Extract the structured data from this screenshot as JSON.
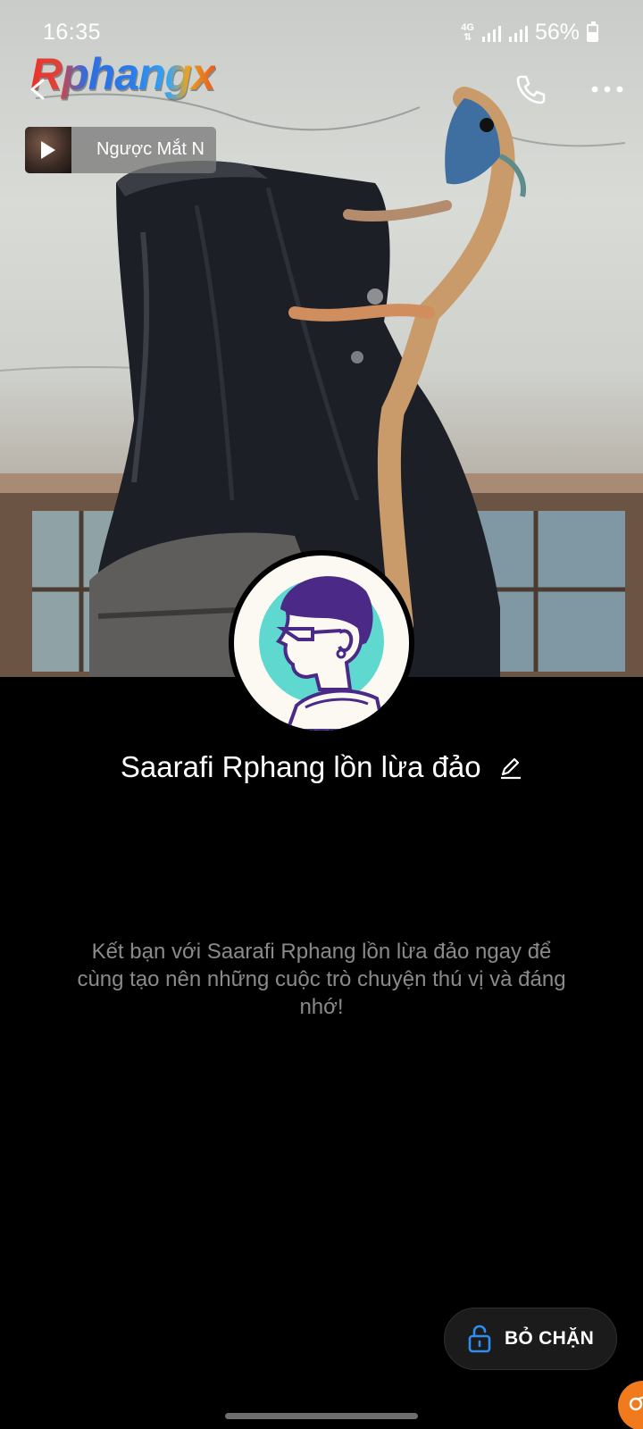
{
  "status_bar": {
    "time": "16:35",
    "network": "4G",
    "battery": "56%",
    "battery_level": 0.56
  },
  "header": {
    "logo_text": "Rphangx"
  },
  "music": {
    "title": "Ngược Mắt N"
  },
  "profile": {
    "name": "Saarafi Rphang lồn lừa đảo"
  },
  "friend_prompt": "Kết bạn với Saarafi Rphang lồn lừa đảo ngay để cùng tạo nên những cuộc trò chuyện thú vị và đáng nhớ!",
  "actions": {
    "unblock_label": "BỎ CHẶN"
  },
  "icons": {
    "back": "back-arrow-icon",
    "call": "phone-icon",
    "more": "more-dots-icon",
    "edit": "pencil-icon",
    "lock": "unlock-icon",
    "play": "play-icon"
  },
  "colors": {
    "background": "#000000",
    "accent_blue": "#2f8cf0",
    "corner_bubble": "#f07a1c",
    "prompt_text": "#8a8a8a"
  }
}
